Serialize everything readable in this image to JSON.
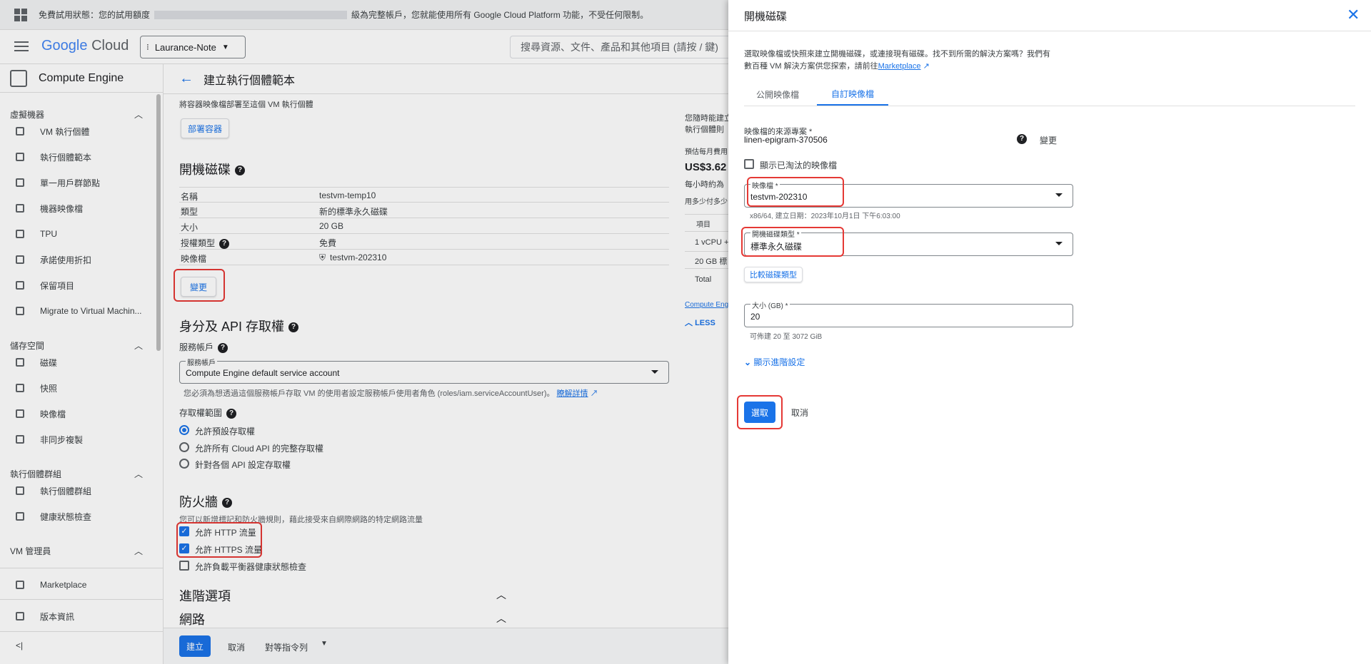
{
  "banner": {
    "text_start": "免費試用狀態：您的試用額度",
    "text_end": "級為完整帳戶，您就能使用所有 Google Cloud Platform 功能，不受任何限制。"
  },
  "header": {
    "logo_google": "Google",
    "logo_cloud": "Cloud",
    "project": "Laurance-Note",
    "search_placeholder": "搜尋資源、文件、產品和其他項目 (請按 / 鍵)"
  },
  "sidebar": {
    "product": "Compute Engine",
    "sections": [
      {
        "label": "虛擬機器",
        "items": [
          "VM 執行個體",
          "執行個體範本",
          "單一用戶群節點",
          "機器映像檔",
          "TPU",
          "承諾使用折扣",
          "保留項目",
          "Migrate to Virtual Machin..."
        ]
      },
      {
        "label": "儲存空間",
        "items": [
          "磁碟",
          "快照",
          "映像檔",
          "非同步複製"
        ]
      },
      {
        "label": "執行個體群組",
        "items": [
          "執行個體群組",
          "健康狀態檢查"
        ]
      },
      {
        "label": "VM 管理員",
        "items": []
      }
    ],
    "marketplace": "Marketplace",
    "release_notes": "版本資訊",
    "collapse": "<|"
  },
  "main": {
    "title": "建立執行個體範本",
    "container_note": "將容器映像檔部署至這個 VM 執行個體",
    "deploy_container": "部署容器",
    "boot_disk": {
      "heading": "開機磁碟",
      "rows": [
        {
          "k": "名稱",
          "v": "testvm-temp10"
        },
        {
          "k": "類型",
          "v": "新的標準永久磁碟"
        },
        {
          "k": "大小",
          "v": "20 GB"
        },
        {
          "k": "授權類型",
          "v": "免費"
        },
        {
          "k": "映像檔",
          "v": "testvm-202310"
        }
      ],
      "change": "變更"
    },
    "identity": {
      "heading": "身分及 API 存取權",
      "service_account_label": "服務帳戶",
      "select_label": "服務帳戶",
      "select_value": "Compute Engine default service account",
      "note": "您必須為想透過這個服務帳戶存取 VM 的使用者設定服務帳戶使用者角色 (roles/iam.serviceAccountUser)。",
      "note_link": "瞭解詳情",
      "scopes_label": "存取權範圍",
      "scopes": [
        "允許預設存取權",
        "允許所有 Cloud API 的完整存取權",
        "針對各個 API 設定存取權"
      ]
    },
    "firewall": {
      "heading": "防火牆",
      "note": "您可以新增標記和防火牆規則，藉此接受來自網際網路的特定網路流量",
      "options": [
        "允許 HTTP 流量",
        "允許 HTTPS 流量",
        "允許負載平衡器健康狀態檢查"
      ]
    },
    "advanced": "進階選項",
    "network": "網路",
    "footer": {
      "create": "建立",
      "cancel": "取消",
      "equiv": "對等指令列"
    }
  },
  "pricing": {
    "lines": [
      "您隨時能建立",
      "執行個體則"
    ],
    "est_label": "預估每月費用",
    "amount": "US$3.62",
    "per_hour": "每小時約為",
    "how_much": "用多少付多少",
    "col_item": "項目",
    "rows": [
      "1 vCPU +",
      "20 GB 標",
      "Total"
    ],
    "link": "Compute Eng",
    "less": "LESS"
  },
  "drawer": {
    "title": "開機磁碟",
    "intro_1": "選取映像檔或快照來建立開機磁碟，或連接現有磁碟。找不到所需的解決方案嗎？我們有",
    "intro_2": "數百種 VM 解決方案供您探索，請前往",
    "intro_link": "Marketplace",
    "tabs": [
      "公開映像檔",
      "自訂映像檔"
    ],
    "source_label": "映像檔的來源專案 *",
    "source_value": "linen-epigram-370506",
    "change": "變更",
    "show_deprecated": "顯示已淘汰的映像檔",
    "image_label": "映像檔 *",
    "image_value": "testvm-202310",
    "image_hint": "x86/64, 建立日期：2023年10月1日 下午6:03:00",
    "disk_type_label": "開機磁碟類型 *",
    "disk_type_value": "標準永久磁碟",
    "compare": "比較磁碟類型",
    "size_label": "大小 (GB) *",
    "size_value": "20",
    "size_hint": "可佈建 20 至 3072 GiB",
    "advanced": "顯示進階設定",
    "select": "選取",
    "cancel": "取消"
  },
  "colors": {
    "accent": "#1a73e8",
    "annotation": "#e53935"
  }
}
